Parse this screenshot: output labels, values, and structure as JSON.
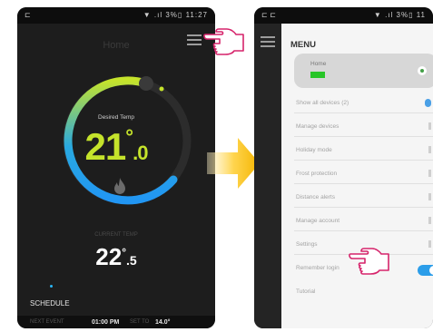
{
  "left_screen": {
    "status_time": "11:27",
    "status_left_icon": "app-notification-icon",
    "status_right_icons": "▼ .ıl 3%▯",
    "title": "Home",
    "desired_label": "Desired Temp",
    "desired_value": "21",
    "desired_decimal": ".0",
    "degree_symbol": "°",
    "current_label": "CURRENT TEMP",
    "current_value": "22",
    "current_decimal": ".5",
    "schedule_label": "SCHEDULE",
    "next_event_label": "NEXT EVENT",
    "next_event_time": "01:00 PM",
    "set_to_label": "SET TO",
    "set_to_value": "14.0°",
    "colors": {
      "accent_green": "#c5e32b",
      "dial_blue": "#29b6f6"
    }
  },
  "right_screen": {
    "status_right_icons": "▼ .ıl 3%▯ 11",
    "menu_title": "MENU",
    "home_card": {
      "label": "Home",
      "swatch_color": "#28c528"
    },
    "items": [
      {
        "label": "Show all devices (2)"
      },
      {
        "label": "Manage devices"
      },
      {
        "label": "Holiday mode"
      },
      {
        "label": "Frost protection"
      },
      {
        "label": "Distance alerts"
      },
      {
        "label": "Manage account"
      },
      {
        "label": "Settings"
      },
      {
        "label": "Remember login",
        "toggle_on": true
      },
      {
        "label": "Tutorial"
      }
    ]
  },
  "icons": [
    "menu-icon",
    "flame-icon",
    "pointing-hand-icon",
    "arrow-right-icon"
  ]
}
